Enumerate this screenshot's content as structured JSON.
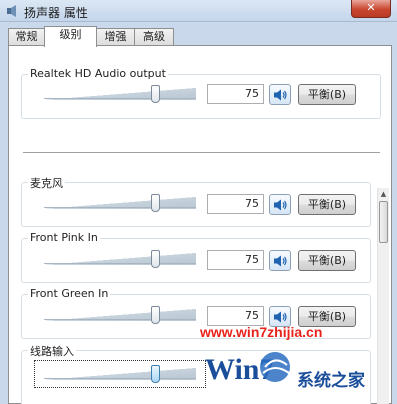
{
  "window": {
    "title": "扬声器 属性",
    "close_glyph": "✕"
  },
  "tabs": [
    {
      "label": "常规",
      "active": false
    },
    {
      "label": "级别",
      "active": true
    },
    {
      "label": "增强",
      "active": false
    },
    {
      "label": "高级",
      "active": false
    }
  ],
  "master": {
    "label": "Realtek HD Audio output",
    "value": "75",
    "level_percent": 75,
    "balance_label": "平衡(B)"
  },
  "channels": [
    {
      "label": "麦克风",
      "value": "75",
      "level_percent": 75,
      "balance_label": "平衡(B)"
    },
    {
      "label": "Front Pink In",
      "value": "75",
      "level_percent": 75,
      "balance_label": "平衡(B)"
    },
    {
      "label": "Front Green In",
      "value": "75",
      "level_percent": 75,
      "balance_label": "平衡(B)"
    },
    {
      "label": "线路输入",
      "level_percent": 75
    }
  ],
  "scrollbar": {
    "up_glyph": "▲"
  },
  "watermark": {
    "url": "www.win7zhijia.cn",
    "brand": "系统之家",
    "logo_text": "Win7"
  },
  "colors": {
    "accent": "#3c7fb1",
    "watermark_red": "#e8231b",
    "watermark_blue": "#1b4e9a"
  }
}
